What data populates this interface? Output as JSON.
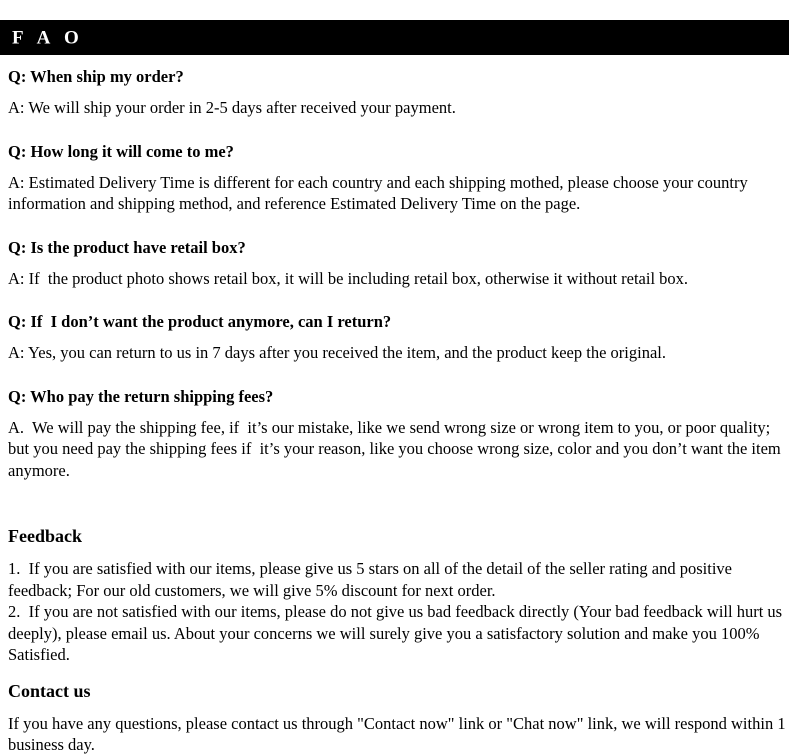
{
  "header": {
    "title": "F A O",
    "background_color": "#000000",
    "text_color": "#ffffff"
  },
  "faq": {
    "items": [
      {
        "question": "Q: When ship my order?",
        "answer": "A: We will ship your order in 2-5 days after received your payment."
      },
      {
        "question": "Q: How long it will come to me?",
        "answer": "A: Estimated Delivery Time is different for each country and each shipping mothed, please choose your country information and shipping method, and reference Estimated Delivery Time on the page."
      },
      {
        "question": "Q: Is the product have retail box?",
        "answer": "A: If  the product photo shows retail box, it will be including retail box, otherwise it without retail box."
      },
      {
        "question": "Q: If  I don’t want the product anymore, can I return?",
        "answer": "A: Yes, you can return to us in 7 days after you received the item, and the product keep the original."
      },
      {
        "question": "Q: Who pay the return shipping fees?",
        "answer": "A.  We will pay the shipping fee, if  it’s our mistake, like we send wrong size or wrong item to you, or poor quality; but you need pay the shipping fees if  it’s your reason, like you choose wrong size, color and you don’t want the item anymore."
      }
    ]
  },
  "feedback": {
    "heading": "Feedback",
    "body": "1.  If you are satisfied with our items, please give us 5 stars on all of the detail of the seller rating and positive feedback; For our old customers, we will give 5% discount for next order.\n2.  If you are not satisfied with our items, please do not give us bad feedback directly (Your bad feedback will hurt us deeply), please email us. About your concerns we will surely give you a satisfactory solution and make you 100% Satisfied."
  },
  "contact": {
    "heading": "Contact us",
    "body": "If you have any questions, please contact us through \"Contact now\" link or \"Chat now\" link, we will respond within 1 business day."
  }
}
